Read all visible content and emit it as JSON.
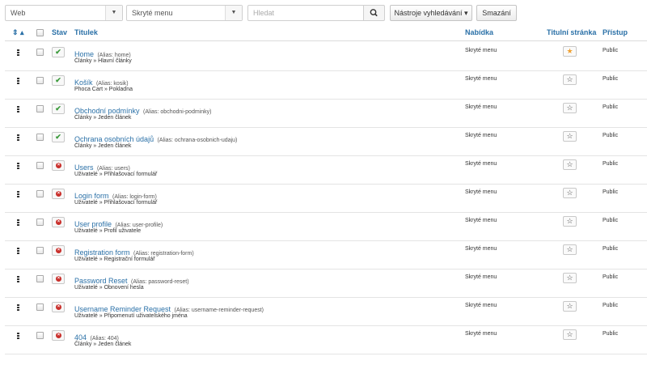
{
  "toolbar": {
    "site_filter": "Web",
    "menu_filter": "Skryté menu",
    "search_placeholder": "Hledat",
    "search_tools_label": "Nástroje vyhledávání ▾",
    "clear_label": "Smazání"
  },
  "table": {
    "headers": {
      "ordering": "⇕ ▴",
      "status": "Stav",
      "title": "Titulek",
      "menu": "Nabídka",
      "home": "Titulní stránka",
      "access": "Přístup"
    },
    "rows": [
      {
        "title": "Home",
        "alias": "(Alias: home)",
        "type": "Články » Hlavní články",
        "published": true,
        "menu": "Skryté menu",
        "home": true,
        "access": "Public"
      },
      {
        "title": "Košík",
        "alias": "(Alias: kosik)",
        "type": "Phoca Cart » Pokladna",
        "published": true,
        "menu": "Skryté menu",
        "home": false,
        "access": "Public"
      },
      {
        "title": "Obchodní podmínky",
        "alias": "(Alias: obchodni-podminky)",
        "type": "Články » Jeden článek",
        "published": true,
        "menu": "Skryté menu",
        "home": false,
        "access": "Public"
      },
      {
        "title": "Ochrana osobních údajů",
        "alias": "(Alias: ochrana-osobnich-udaju)",
        "type": "Články » Jeden článek",
        "published": true,
        "menu": "Skryté menu",
        "home": false,
        "access": "Public"
      },
      {
        "title": "Users",
        "alias": "(Alias: users)",
        "type": "Uživatelé » Přihlašovací formulář",
        "published": false,
        "menu": "Skryté menu",
        "home": false,
        "access": "Public"
      },
      {
        "title": "Login form",
        "alias": "(Alias: login-form)",
        "type": "Uživatelé » Přihlašovací formulář",
        "published": false,
        "menu": "Skryté menu",
        "home": false,
        "access": "Public"
      },
      {
        "title": "User profile",
        "alias": "(Alias: user-profile)",
        "type": "Uživatelé » Profil uživatele",
        "published": false,
        "menu": "Skryté menu",
        "home": false,
        "access": "Public"
      },
      {
        "title": "Registration form",
        "alias": "(Alias: registration-form)",
        "type": "Uživatelé » Registrační formulář",
        "published": false,
        "menu": "Skryté menu",
        "home": false,
        "access": "Public"
      },
      {
        "title": "Password Reset",
        "alias": "(Alias: password-reset)",
        "type": "Uživatelé » Obnovení hesla",
        "published": false,
        "menu": "Skryté menu",
        "home": false,
        "access": "Public"
      },
      {
        "title": "Username Reminder Request",
        "alias": "(Alias: username-reminder-request)",
        "type": "Uživatelé » Připomenutí uživatelského jména",
        "published": false,
        "menu": "Skryté menu",
        "home": false,
        "access": "Public"
      },
      {
        "title": "404",
        "alias": "(Alias: 404)",
        "type": "Články » Jeden článek",
        "published": false,
        "menu": "Skryté menu",
        "home": false,
        "access": "Public"
      }
    ]
  },
  "colors": {
    "link": "#2a70a7",
    "published": "#3b9a3b",
    "unpublished": "#c9302c",
    "home_star": "#f0a030"
  },
  "icons": {
    "search": "search-icon",
    "drag": "drag-handle-icon",
    "published": "check-icon",
    "unpublished": "unpublished-icon",
    "home": "star-icon"
  }
}
